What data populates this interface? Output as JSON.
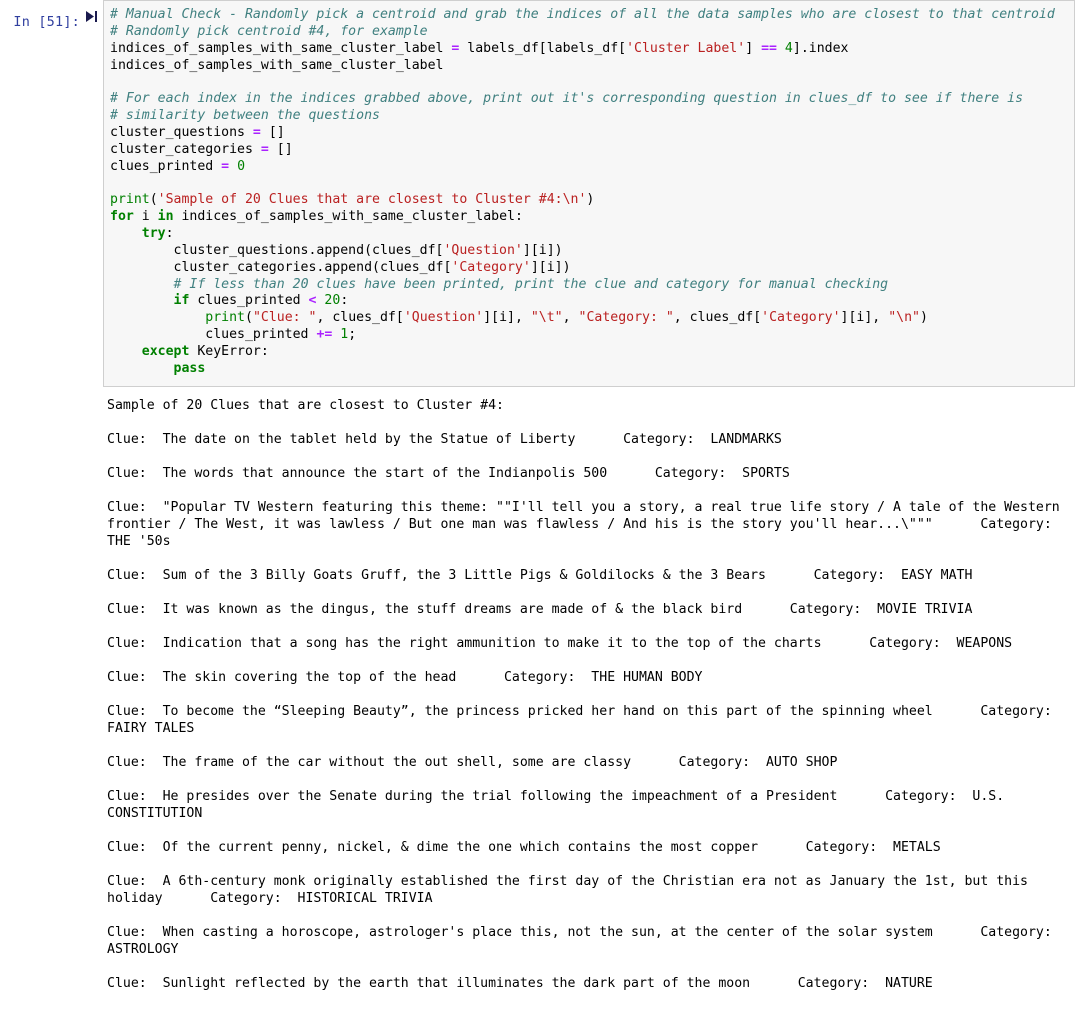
{
  "cell": {
    "prompt": "In [51]:",
    "run_icon_name": "step-forward-icon",
    "execution_count": 51
  },
  "colors": {
    "comment": "#408080",
    "keyword": "#008000",
    "string": "#BA2121",
    "number": "#008000",
    "operator": "#AA22FF",
    "prompt": "#303F9F",
    "cell_background": "#f7f7f7",
    "cell_border": "#cfcfcf",
    "page_background": "#ffffff"
  },
  "code": {
    "lines": [
      {
        "tokens": [
          {
            "t": "cm",
            "v": "# Manual Check - Randomly pick a centroid and grab the indices of all the data samples who are closest to that centroid"
          }
        ]
      },
      {
        "tokens": [
          {
            "t": "cm",
            "v": "# Randomly pick centroid #4, for example"
          }
        ]
      },
      {
        "tokens": [
          {
            "t": "nm",
            "v": "indices_of_samples_with_same_cluster_label "
          },
          {
            "t": "op",
            "v": "="
          },
          {
            "t": "nm",
            "v": " labels_df[labels_df["
          },
          {
            "t": "str",
            "v": "'Cluster Label'"
          },
          {
            "t": "nm",
            "v": "] "
          },
          {
            "t": "op",
            "v": "=="
          },
          {
            "t": "nm",
            "v": " "
          },
          {
            "t": "num",
            "v": "4"
          },
          {
            "t": "nm",
            "v": "].index"
          }
        ]
      },
      {
        "tokens": [
          {
            "t": "nm",
            "v": "indices_of_samples_with_same_cluster_label"
          }
        ]
      },
      {
        "tokens": [
          {
            "t": "nm",
            "v": ""
          }
        ]
      },
      {
        "tokens": [
          {
            "t": "cm",
            "v": "# For each index in the indices grabbed above, print out it's corresponding question in clues_df to see if there is"
          }
        ]
      },
      {
        "tokens": [
          {
            "t": "cm",
            "v": "# similarity between the questions"
          }
        ]
      },
      {
        "tokens": [
          {
            "t": "nm",
            "v": "cluster_questions "
          },
          {
            "t": "op",
            "v": "="
          },
          {
            "t": "nm",
            "v": " []"
          }
        ]
      },
      {
        "tokens": [
          {
            "t": "nm",
            "v": "cluster_categories "
          },
          {
            "t": "op",
            "v": "="
          },
          {
            "t": "nm",
            "v": " []"
          }
        ]
      },
      {
        "tokens": [
          {
            "t": "nm",
            "v": "clues_printed "
          },
          {
            "t": "op",
            "v": "="
          },
          {
            "t": "nm",
            "v": " "
          },
          {
            "t": "num",
            "v": "0"
          }
        ]
      },
      {
        "tokens": [
          {
            "t": "nm",
            "v": ""
          }
        ]
      },
      {
        "tokens": [
          {
            "t": "bif",
            "v": "print"
          },
          {
            "t": "nm",
            "v": "("
          },
          {
            "t": "str",
            "v": "'Sample of 20 Clues that are closest to Cluster #4:\\n'"
          },
          {
            "t": "nm",
            "v": ")"
          }
        ]
      },
      {
        "tokens": [
          {
            "t": "kw",
            "v": "for"
          },
          {
            "t": "nm",
            "v": " i "
          },
          {
            "t": "kw",
            "v": "in"
          },
          {
            "t": "nm",
            "v": " indices_of_samples_with_same_cluster_label:"
          }
        ]
      },
      {
        "tokens": [
          {
            "t": "nm",
            "v": "    "
          },
          {
            "t": "kw",
            "v": "try"
          },
          {
            "t": "nm",
            "v": ":"
          }
        ]
      },
      {
        "tokens": [
          {
            "t": "nm",
            "v": "        cluster_questions.append(clues_df["
          },
          {
            "t": "str",
            "v": "'Question'"
          },
          {
            "t": "nm",
            "v": "][i])"
          }
        ]
      },
      {
        "tokens": [
          {
            "t": "nm",
            "v": "        cluster_categories.append(clues_df["
          },
          {
            "t": "str",
            "v": "'Category'"
          },
          {
            "t": "nm",
            "v": "][i])"
          }
        ]
      },
      {
        "tokens": [
          {
            "t": "nm",
            "v": "        "
          },
          {
            "t": "cm",
            "v": "# If less than 20 clues have been printed, print the clue and category for manual checking"
          }
        ]
      },
      {
        "tokens": [
          {
            "t": "nm",
            "v": "        "
          },
          {
            "t": "kw",
            "v": "if"
          },
          {
            "t": "nm",
            "v": " clues_printed "
          },
          {
            "t": "op",
            "v": "<"
          },
          {
            "t": "nm",
            "v": " "
          },
          {
            "t": "num",
            "v": "20"
          },
          {
            "t": "nm",
            "v": ":"
          }
        ]
      },
      {
        "tokens": [
          {
            "t": "nm",
            "v": "            "
          },
          {
            "t": "bif",
            "v": "print"
          },
          {
            "t": "nm",
            "v": "("
          },
          {
            "t": "str",
            "v": "\"Clue: \""
          },
          {
            "t": "nm",
            "v": ", clues_df["
          },
          {
            "t": "str",
            "v": "'Question'"
          },
          {
            "t": "nm",
            "v": "][i], "
          },
          {
            "t": "str",
            "v": "\"\\t\""
          },
          {
            "t": "nm",
            "v": ", "
          },
          {
            "t": "str",
            "v": "\"Category: \""
          },
          {
            "t": "nm",
            "v": ", clues_df["
          },
          {
            "t": "str",
            "v": "'Category'"
          },
          {
            "t": "nm",
            "v": "][i], "
          },
          {
            "t": "str",
            "v": "\"\\n\""
          },
          {
            "t": "nm",
            "v": ")"
          }
        ]
      },
      {
        "tokens": [
          {
            "t": "nm",
            "v": "            clues_printed "
          },
          {
            "t": "op",
            "v": "+="
          },
          {
            "t": "nm",
            "v": " "
          },
          {
            "t": "num",
            "v": "1"
          },
          {
            "t": "nm",
            "v": ";"
          }
        ]
      },
      {
        "tokens": [
          {
            "t": "nm",
            "v": "    "
          },
          {
            "t": "kw",
            "v": "except"
          },
          {
            "t": "nm",
            "v": " KeyError:"
          }
        ]
      },
      {
        "tokens": [
          {
            "t": "nm",
            "v": "        "
          },
          {
            "t": "kw",
            "v": "pass"
          }
        ]
      }
    ]
  },
  "output": {
    "header": "Sample of 20 Clues that are closest to Cluster #4:",
    "clue_prefix": "Clue:",
    "category_prefix": "Category:",
    "clues": [
      {
        "clue": "The date on the tablet held by the Statue of Liberty",
        "category": "LANDMARKS",
        "line": "Clue:  The date on the tablet held by the Statue of Liberty \t Category:  LANDMARKS"
      },
      {
        "clue": "The words that announce the start of the Indianpolis 500",
        "category": "SPORTS",
        "line": "Clue:  The words that announce the start of the Indianpolis 500 \t Category:  SPORTS"
      },
      {
        "clue": "\"Popular TV Western featuring this theme: \"\"I'll tell you a story, a real true life story / A tale of the Western frontier / The West, it was lawless / But one man was flawless / And his is the story you'll hear...\\\"\"\"",
        "category": "THE '50s",
        "line": "Clue:  \"Popular TV Western featuring this theme: \"\"I'll tell you a story, a real true life story / A tale of the Western frontier / The West, it was lawless / But one man was flawless / And his is the story you'll hear...\\\"\"\" \t Category:  THE '50s"
      },
      {
        "clue": "Sum of the 3 Billy Goats Gruff, the 3 Little Pigs & Goldilocks & the 3 Bears",
        "category": "EASY MATH",
        "line": "Clue:  Sum of the 3 Billy Goats Gruff, the 3 Little Pigs & Goldilocks & the 3 Bears \t Category:  EASY MATH"
      },
      {
        "clue": "It was known as the dingus, the stuff dreams are made of & the black bird",
        "category": "MOVIE TRIVIA",
        "line": "Clue:  It was known as the dingus, the stuff dreams are made of & the black bird \t Category:  MOVIE TRIVIA"
      },
      {
        "clue": "Indication that a song has the right ammunition to make it to the top of the charts",
        "category": "WEAPONS",
        "line": "Clue:  Indication that a song has the right ammunition to make it to the top of the charts \t Category:  WEAPONS"
      },
      {
        "clue": "The skin covering the top of the head",
        "category": "THE HUMAN BODY",
        "line": "Clue:  The skin covering the top of the head \t Category:  THE HUMAN BODY"
      },
      {
        "clue": "To become the “Sleeping Beauty”, the princess pricked her hand on this part of the spinning wheel",
        "category": "FAIRY TALES",
        "line": "Clue:  To become the “Sleeping Beauty”, the princess pricked her hand on this part of the spinning wheel \t Category:  FAIRY TALES"
      },
      {
        "clue": "The frame of the car without the out shell, some are classy",
        "category": "AUTO SHOP",
        "line": "Clue:  The frame of the car without the out shell, some are classy \t Category:  AUTO SHOP"
      },
      {
        "clue": "He presides over the Senate during the trial following the impeachment of a President",
        "category": "U.S. CONSTITUTION",
        "line": "Clue:  He presides over the Senate during the trial following the impeachment of a President \t Category:  U.S. CONSTITUTION"
      },
      {
        "clue": "Of the current penny, nickel, & dime the one which contains the most copper",
        "category": "METALS",
        "line": "Clue:  Of the current penny, nickel, & dime the one which contains the most copper \t Category:  METALS"
      },
      {
        "clue": "A 6th-century monk originally established the first day of the Christian era not as January the 1st, but this holiday",
        "category": "HISTORICAL TRIVIA",
        "line": "Clue:  A 6th-century monk originally established the first day of the Christian era not as January the 1st, but this holiday \t Category:  HISTORICAL TRIVIA"
      },
      {
        "clue": "When casting a horoscope, astrologer's place this, not the sun, at the center of the solar system",
        "category": "ASTROLOGY",
        "line": "Clue:  When casting a horoscope, astrologer's place this, not the sun, at the center of the solar system \t Category:  ASTROLOGY"
      },
      {
        "clue": "Sunlight reflected by the earth that illuminates the dark part of the moon",
        "category": "NATURE",
        "line": "Clue:  Sunlight reflected by the earth that illuminates the dark part of the moon \t Category:  NATURE"
      }
    ]
  }
}
